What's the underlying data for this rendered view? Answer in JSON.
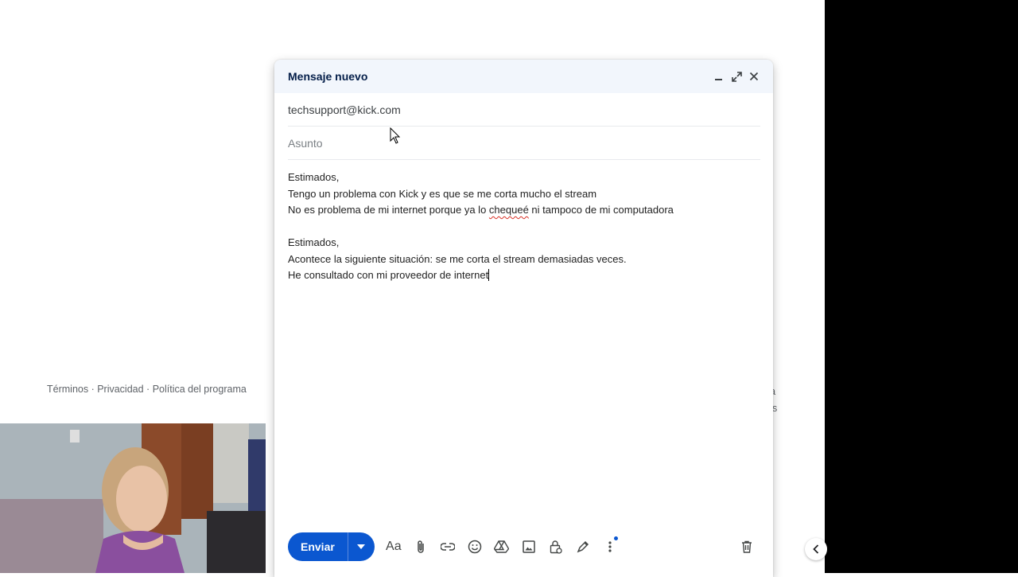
{
  "compose": {
    "title": "Mensaje nuevo",
    "to": "techsupport@kick.com",
    "subject_placeholder": "Asunto",
    "body": {
      "line1": "Estimados,",
      "line2": "Tengo un problema con Kick y es que se me corta mucho el stream",
      "line3_before": "No es problema de mi internet porque ya lo ",
      "line3_misspelled": "chequeé",
      "line3_after": " ni tampoco de mi computadora",
      "line5": "Estimados,",
      "line6": "Acontece la siguiente situación: se me corta el stream demasiadas veces.",
      "line7": "He consultado con mi proveedor de internet"
    },
    "send_label": "Enviar"
  },
  "footer": {
    "terms": "Términos",
    "sep": " · ",
    "privacy": "Privacidad",
    "policy": "Política del programa",
    "right_line1": "ra",
    "right_line2": "es"
  },
  "colors": {
    "accent": "#0b57d0",
    "header_bg": "#f2f6fc",
    "title": "#041e49"
  }
}
